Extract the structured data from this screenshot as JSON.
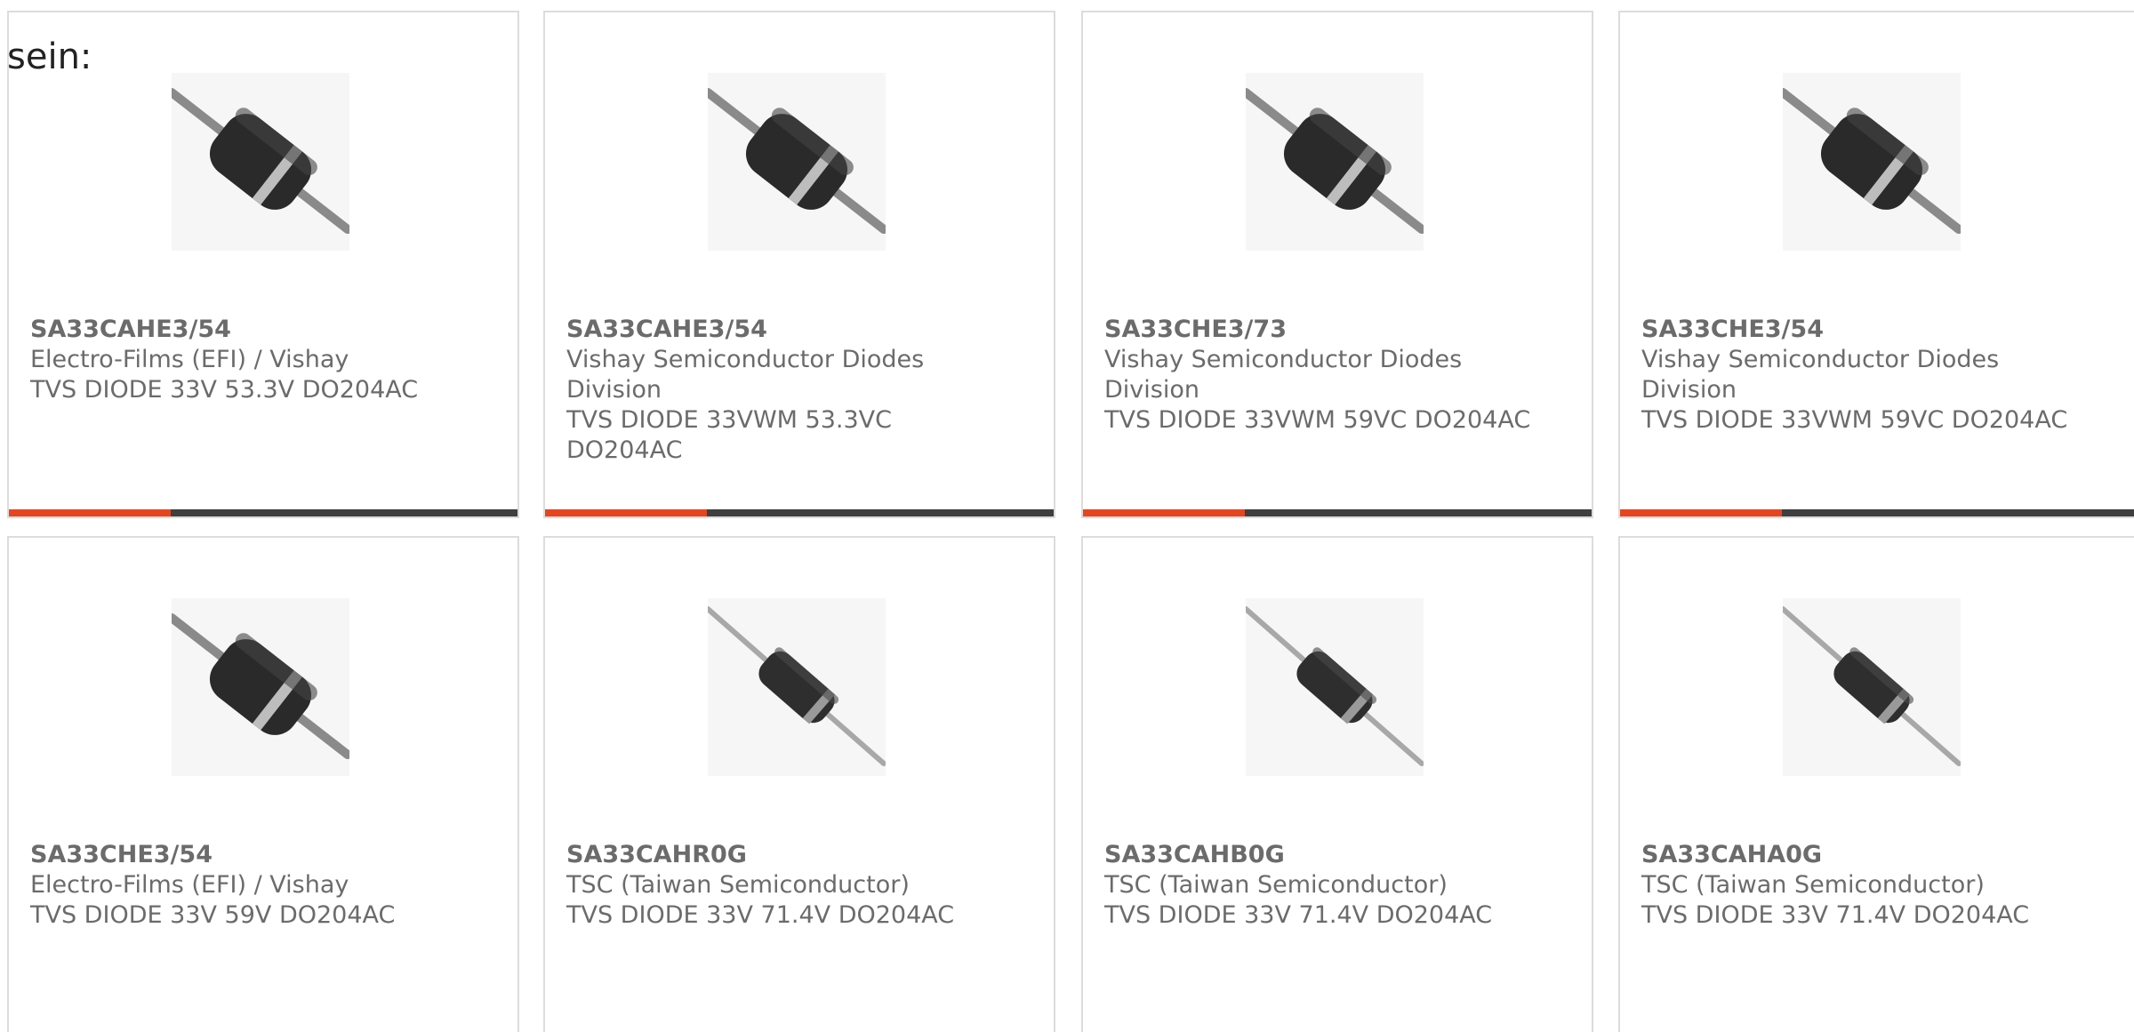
{
  "intro_text": "sein:",
  "colors": {
    "card_border": "#dcdcdc",
    "text": "#6b6b6b",
    "accent_bar": "#e8451f",
    "bar": "#3f3f3f"
  },
  "products": [
    {
      "part_number": "SA33CAHE3/54",
      "manufacturer": "Electro-Films (EFI) / Vishay",
      "description": "TVS DIODE 33V 53.3V DO204AC",
      "image_icon": "diode-large-icon"
    },
    {
      "part_number": "SA33CAHE3/54",
      "manufacturer": "Vishay Semiconductor Diodes Division",
      "description": "TVS DIODE 33VWM 53.3VC DO204AC",
      "image_icon": "diode-large-icon"
    },
    {
      "part_number": "SA33CHE3/73",
      "manufacturer": "Vishay Semiconductor Diodes Division",
      "description": "TVS DIODE 33VWM 59VC DO204AC",
      "image_icon": "diode-large-icon"
    },
    {
      "part_number": "SA33CHE3/54",
      "manufacturer": "Vishay Semiconductor Diodes Division",
      "description": "TVS DIODE 33VWM 59VC DO204AC",
      "image_icon": "diode-large-icon"
    },
    {
      "part_number": "SA33CHE3/54",
      "manufacturer": "Electro-Films (EFI) / Vishay",
      "description": "TVS DIODE 33V 59V DO204AC",
      "image_icon": "diode-large-icon"
    },
    {
      "part_number": "SA33CAHR0G",
      "manufacturer": "TSC (Taiwan Semiconductor)",
      "description": "TVS DIODE 33V 71.4V DO204AC",
      "image_icon": "diode-slim-icon"
    },
    {
      "part_number": "SA33CAHB0G",
      "manufacturer": "TSC (Taiwan Semiconductor)",
      "description": "TVS DIODE 33V 71.4V DO204AC",
      "image_icon": "diode-slim-icon"
    },
    {
      "part_number": "SA33CAHA0G",
      "manufacturer": "TSC (Taiwan Semiconductor)",
      "description": "TVS DIODE 33V 71.4V DO204AC",
      "image_icon": "diode-slim-icon"
    }
  ]
}
